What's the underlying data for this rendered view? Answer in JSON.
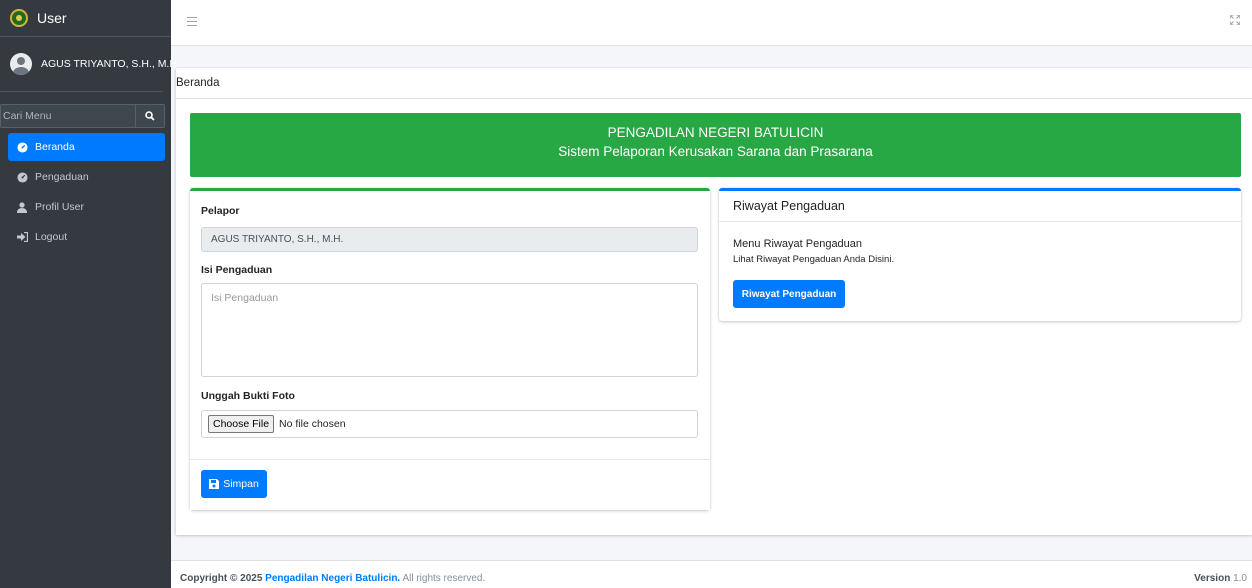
{
  "brand": {
    "name": "User"
  },
  "user": {
    "name": "AGUS TRIYANTO, S.H., M.H."
  },
  "sidebar": {
    "search_placeholder": "Cari Menu",
    "items": [
      {
        "label": "Beranda",
        "icon": "dashboard-icon",
        "active": true
      },
      {
        "label": "Pengaduan",
        "icon": "dashboard-icon",
        "active": false
      },
      {
        "label": "Profil User",
        "icon": "user-icon",
        "active": false
      },
      {
        "label": "Logout",
        "icon": "sign-out-icon",
        "active": false
      }
    ]
  },
  "page": {
    "title": "Beranda"
  },
  "banner": {
    "title": "PENGADILAN NEGERI BATULICIN",
    "subtitle": "Sistem Pelaporan Kerusakan Sarana dan Prasarana"
  },
  "form": {
    "reporter_label": "Pelapor",
    "reporter_value": "AGUS TRIYANTO, S.H., M.H.",
    "complaint_label": "Isi Pengaduan",
    "complaint_placeholder": "Isi Pengaduan",
    "upload_label": "Unggah Bukti Foto",
    "file_button": "Choose File",
    "file_status": "No file chosen",
    "submit_label": "Simpan"
  },
  "history": {
    "header": "Riwayat Pengaduan",
    "title": "Menu Riwayat Pengaduan",
    "subtitle": "Lihat Riwayat Pengaduan Anda Disini.",
    "button": "Riwayat Pengaduan"
  },
  "footer": {
    "copyright_prefix": "Copyright © 2025",
    "org": "Pengadilan Negeri Batulicin.",
    "rights": "All rights reserved.",
    "version_label": "Version",
    "version_value": "1.0"
  },
  "colors": {
    "sidebar": "#343a40",
    "primary": "#007bff",
    "success": "#28a745"
  }
}
